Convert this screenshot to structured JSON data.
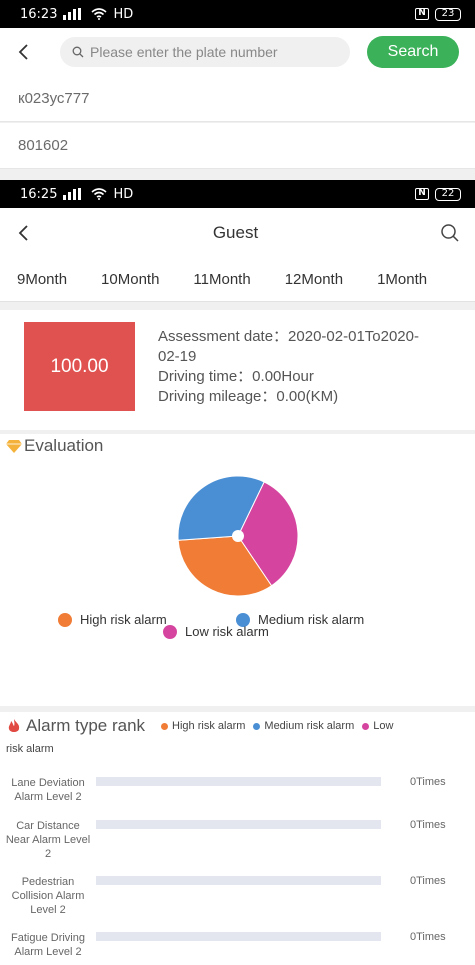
{
  "screen1": {
    "status": {
      "time": "16:23",
      "network": "HD",
      "battery": "23"
    },
    "search": {
      "placeholder": "Please enter the plate number",
      "button_label": "Search"
    },
    "results": [
      "к023ус777",
      "801602"
    ]
  },
  "screen2": {
    "status": {
      "time": "16:25",
      "network": "HD",
      "battery": "22"
    },
    "header": {
      "title": "Guest"
    },
    "tabs": [
      "9Month",
      "10Month",
      "11Month",
      "12Month",
      "1Month"
    ],
    "summary": {
      "score": "100.00",
      "assessment_line1": "Assessment date：2020-02-01To2020-",
      "assessment_line2": "02-19",
      "driving_time": "Driving time：0.00Hour",
      "driving_mileage": "Driving mileage：0.00(KM)"
    },
    "evaluation": {
      "title": "Evaluation",
      "legend": {
        "high": "High risk alarm",
        "medium": "Medium risk alarm",
        "low": "Low risk alarm"
      },
      "colors": {
        "high": "#f07c35",
        "medium": "#4a8fd4",
        "low": "#d5459f"
      }
    },
    "chart_data": {
      "type": "pie",
      "categories": [
        "High risk alarm",
        "Medium risk alarm",
        "Low risk alarm"
      ],
      "values": [
        33.3,
        33.3,
        33.4
      ]
    },
    "alarm_rank": {
      "title": "Alarm type rank",
      "legend_high": "High risk alarm",
      "legend_medium": "Medium risk alarm",
      "legend_low_part1": "Low",
      "legend_low_part2": "risk alarm",
      "rows": [
        {
          "line1": "Lane Deviation",
          "line2": "Alarm Level 2",
          "line3": "",
          "times": "0Times"
        },
        {
          "line1": "Car Distance",
          "line2": "Near Alarm Level",
          "line3": "2",
          "times": "0Times"
        },
        {
          "line1": "Pedestrian",
          "line2": "Collision Alarm",
          "line3": "Level 2",
          "times": "0Times"
        },
        {
          "line1": "Fatigue Driving",
          "line2": "Alarm Level 2",
          "line3": "",
          "times": "0Times"
        }
      ]
    }
  }
}
